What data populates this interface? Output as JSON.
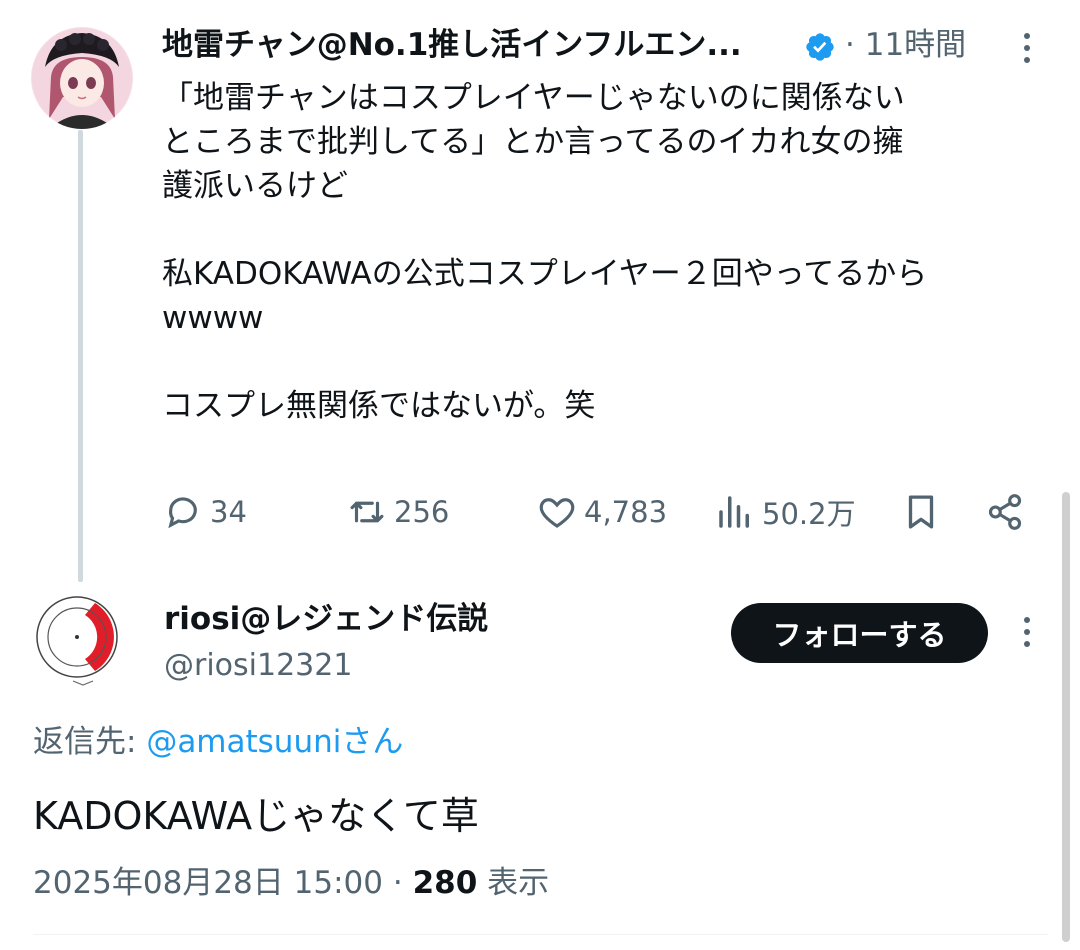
{
  "tweet": {
    "author_name": "地雷チャン@No.1推し活インフルエン...",
    "separator": "·",
    "time": "11時間",
    "text": "「地雷チャンはコスプレイヤーじゃないのに関係ない\nところまで批判してる」とか言ってるのイカれ女の擁\n護派いるけど\n\n私KADOKAWAの公式コスプレイヤー２回やってるから\nwwww\n\nコスプレ無関係ではないが。笑",
    "actions": {
      "replies": "34",
      "reposts": "256",
      "likes": "4,783",
      "views": "50.2万"
    }
  },
  "reply": {
    "author_name": "riosi@レジェンド伝説",
    "handle": "@riosi12321",
    "follow_label": "フォローする",
    "reply_to_label": "返信先: ",
    "reply_to_mention": "@amatsuuni",
    "reply_to_suffix": "さん",
    "text": "KADOKAWAじゃなくて草",
    "date": "2025年08月28日 15:00",
    "separator": "·",
    "views_count": "280",
    "views_label": "表示"
  },
  "colors": {
    "accent": "#1d9bf0",
    "text": "#0f1419",
    "muted": "#536471",
    "follow_bg": "#0f1419"
  },
  "icons": [
    "avatar",
    "verified-badge-icon",
    "more-icon",
    "reply-icon",
    "repost-icon",
    "like-icon",
    "views-icon",
    "bookmark-icon",
    "share-icon"
  ]
}
